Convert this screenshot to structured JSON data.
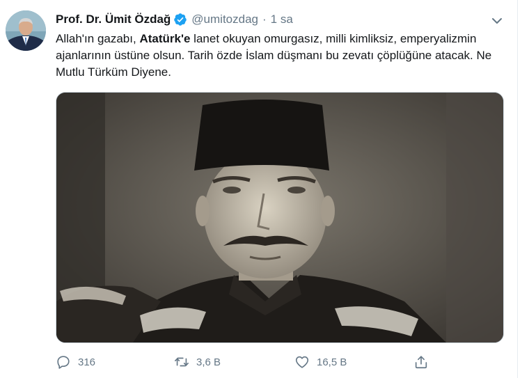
{
  "tweet": {
    "author_name": "Prof. Dr. Ümit Özdağ",
    "handle": "@umitozdag",
    "separator": "·",
    "time": "1 sa",
    "text_before": "Allah'ın gazabı, ",
    "text_bold": "Atatürk'e",
    "text_after": " lanet okuyan omurgasız, milli kimliksiz, emperyalizmin ajanlarının üstüne olsun. Tarih özde İslam düşmanı bu zevatı çöplüğüne atacak. Ne Mutlu Türküm Diyene.",
    "photo_description_icon": "sepia-portrait-photo"
  },
  "actions": {
    "reply_count": "316",
    "retweet_count": "3,6 B",
    "like_count": "16,5 B"
  },
  "icons": {
    "verified": "verified-badge-icon",
    "caret": "chevron-down-icon",
    "reply": "reply-icon",
    "retweet": "retweet-icon",
    "like": "heart-icon",
    "share": "share-icon"
  },
  "colors": {
    "verified": "#1da1f2",
    "secondary_text": "#657786",
    "primary_text": "#14171a"
  }
}
